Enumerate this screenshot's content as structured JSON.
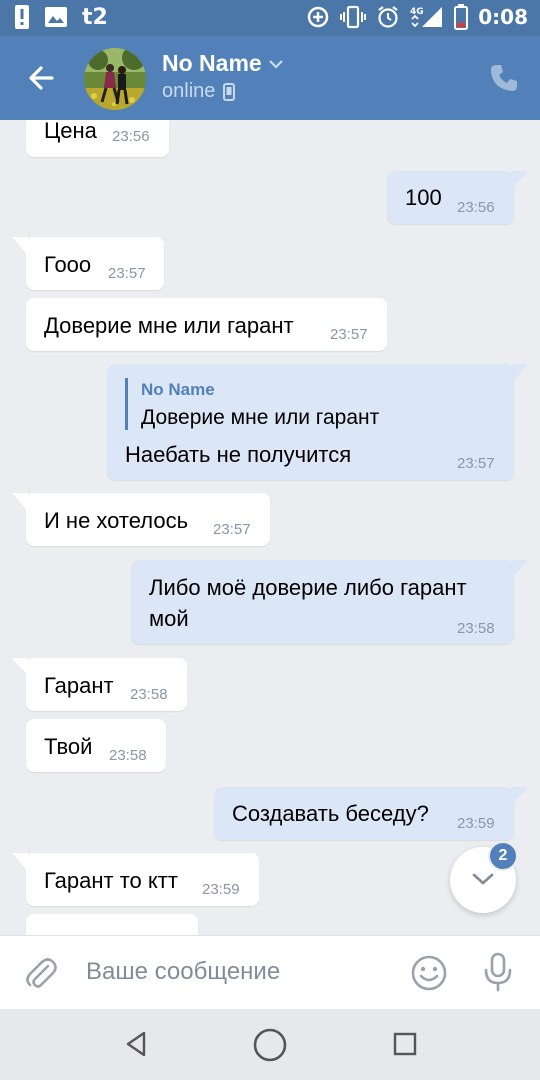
{
  "status_bar": {
    "carrier": "t2",
    "network": "4G",
    "time": "0:08",
    "icons": [
      "alert-icon",
      "image-icon",
      "data-saver-icon",
      "vibrate-icon",
      "alarm-icon",
      "signal-icon",
      "battery-low-icon"
    ]
  },
  "header": {
    "name": "No Name",
    "status": "online",
    "icons": [
      "back-arrow-icon",
      "chevron-down-icon",
      "mobile-icon",
      "phone-icon"
    ]
  },
  "messages": [
    {
      "dir": "in",
      "text": "Цена",
      "time": "23:56"
    },
    {
      "dir": "out",
      "text": "100",
      "time": "23:56"
    },
    {
      "dir": "in",
      "text": "Гооо",
      "time": "23:57"
    },
    {
      "dir": "in",
      "text": "Доверие мне или гарант",
      "time": "23:57"
    },
    {
      "dir": "out",
      "reply_name": "No Name",
      "reply_text": "Доверие мне или гарант",
      "text": "Наебать не получится",
      "time": "23:57"
    },
    {
      "dir": "in",
      "text": "И не хотелось",
      "time": "23:57"
    },
    {
      "dir": "out",
      "text_line1": "Либо моё доверие либо гарант",
      "text_line2": "мой",
      "time": "23:58"
    },
    {
      "dir": "in",
      "text": "Гарант",
      "time": "23:58"
    },
    {
      "dir": "in",
      "text": "Твой",
      "time": "23:58"
    },
    {
      "dir": "out",
      "text": "Создавать беседу?",
      "time": "23:59"
    },
    {
      "dir": "in",
      "text": "Гарант то ктт",
      "time": "23:59"
    }
  ],
  "scroll_fab": {
    "badge": "2",
    "icon": "chevron-down-icon"
  },
  "input": {
    "placeholder": "Ваше сообщение",
    "icons": [
      "paperclip-icon",
      "smile-icon",
      "mic-icon"
    ]
  },
  "nav": {
    "icons": [
      "nav-back-icon",
      "nav-home-icon",
      "nav-recents-icon"
    ]
  },
  "colors": {
    "header": "#5181b8",
    "status_bar": "#4a76a8",
    "chat_bg": "#ebedf0",
    "out_bubble": "#dbe7f6",
    "in_bubble": "#ffffff",
    "accent": "#5181b8"
  }
}
